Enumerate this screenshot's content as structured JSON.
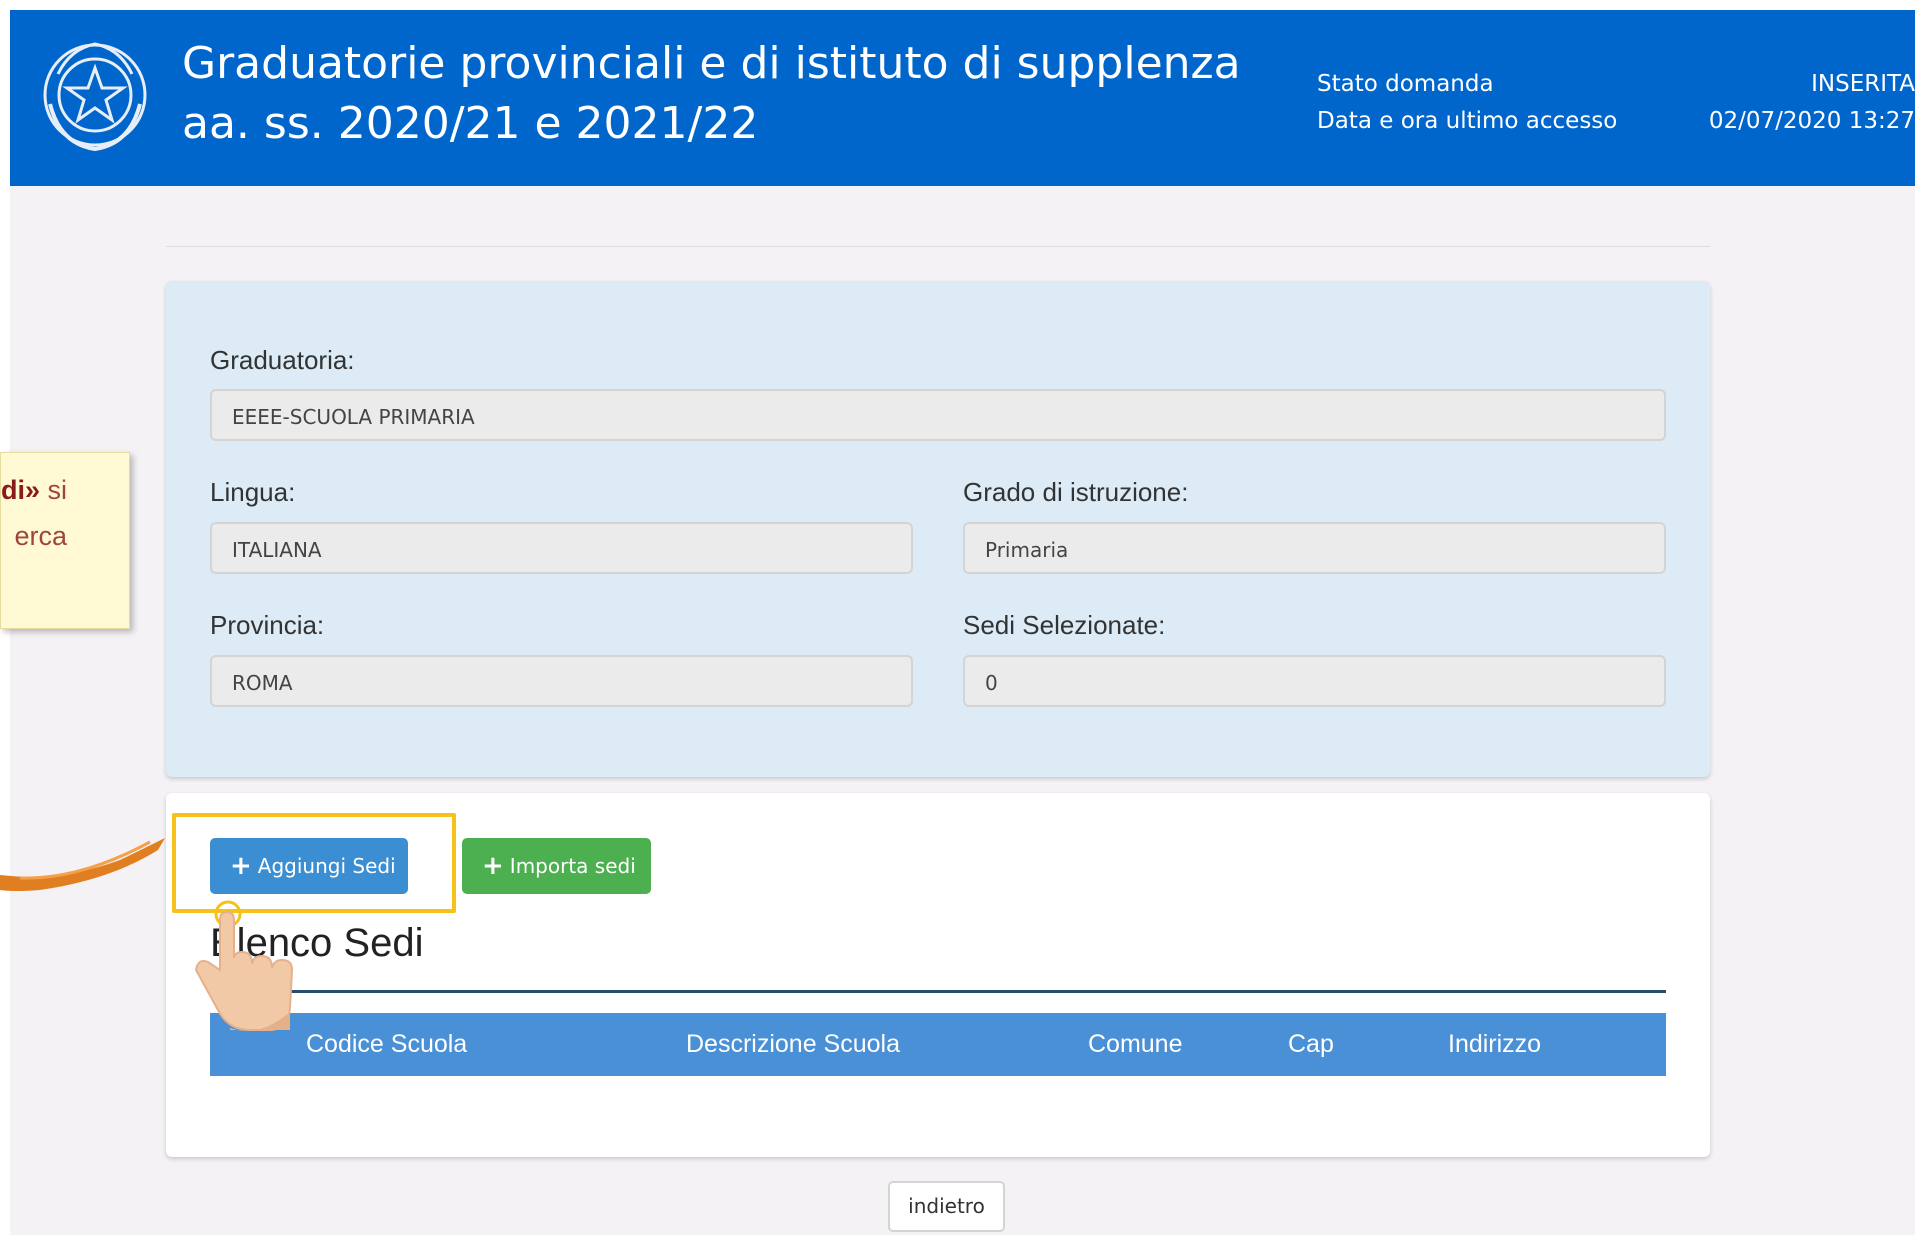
{
  "header": {
    "title_line1": "Graduatorie provinciali e di istituto di supplenza",
    "title_line2": "aa. ss. 2020/21 e 2021/22",
    "status_label": "Stato domanda",
    "status_value": "INSERITA",
    "last_access_label": "Data e ora ultimo accesso",
    "last_access_value": "02/07/2020 13:27"
  },
  "form": {
    "graduatoria_label": "Graduatoria:",
    "graduatoria_value": "EEEE-SCUOLA PRIMARIA",
    "lingua_label": "Lingua:",
    "lingua_value": "ITALIANA",
    "grado_label": "Grado di istruzione:",
    "grado_value": "Primaria",
    "provincia_label": "Provincia:",
    "provincia_value": "ROMA",
    "sedi_selezionate_label": "Sedi Selezionate:",
    "sedi_selezionate_value": "0"
  },
  "actions": {
    "add_label": "Aggiungi Sedi",
    "import_label": "Importa sedi",
    "back_label": "indietro"
  },
  "list": {
    "title": "Elenco Sedi",
    "columns": [
      "Codice Scuola",
      "Descrizione Scuola",
      "Comune",
      "Cap",
      "Indirizzo"
    ]
  },
  "callout": {
    "line1_bold": "di»",
    "line1_rest": " si",
    "line2": "erca"
  },
  "colors": {
    "header_bg": "#0066cc",
    "info_panel_bg": "#dcebf5",
    "add_button": "#3c8ed2",
    "import_button": "#4caf50",
    "table_header": "#4a90d6",
    "highlight": "#f6c21a"
  }
}
